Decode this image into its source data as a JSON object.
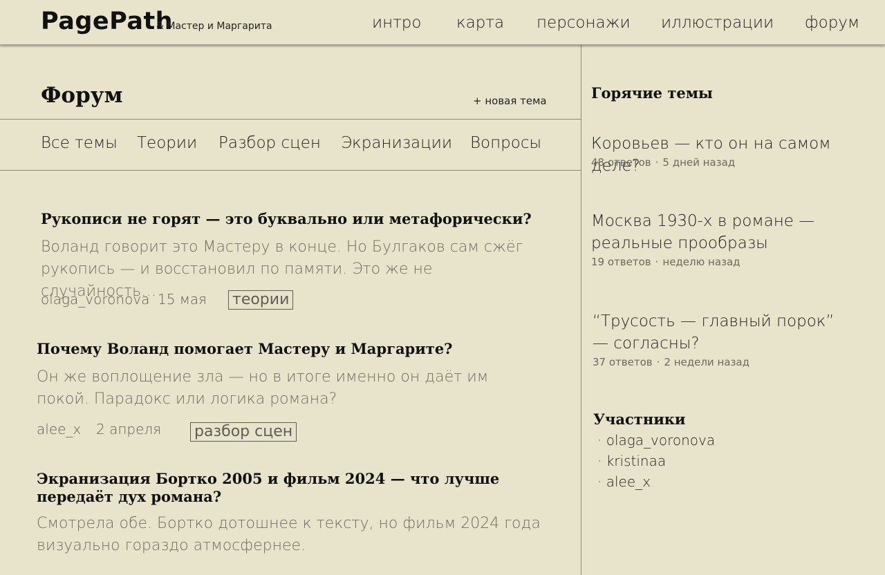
{
  "header": {
    "logo": "PagePath",
    "subtitle": "& Мастер и Маргарита",
    "nav": [
      "интро",
      "карта",
      "персонажи",
      "иллюстрации",
      "форум"
    ]
  },
  "forum": {
    "title": "Форум",
    "new_topic": "+ новая тема",
    "categories": [
      "Все темы",
      "Теории",
      "Разбор сцен",
      "Экранизации",
      "Вопросы"
    ]
  },
  "posts": [
    {
      "title": "Рукописи не горят — это буквально или метафорически?",
      "body": "Воланд говорит это Мастеру в конце. Но Булгаков сам сжёг рукопись — и восстановил по памяти. Это же не случайность…",
      "author": "olaga_voronova",
      "date": "15 мая",
      "tag": "теории"
    },
    {
      "title": "Почему Воланд помогает Мастеру и Маргарите?",
      "body": "Он же воплощение зла — но в итоге именно он даёт им покой. Парадокс или логика романа?",
      "author": "alee_x",
      "date": "2 апреля",
      "tag": "разбор сцен"
    },
    {
      "title": "Экранизация Бортко 2005 и фильм 2024 — что лучше передаёт дух романа?",
      "body": "Смотрела обе. Бортко дотошнее к тексту, но фильм 2024 года визуально гораздо атмосфернее."
    }
  ],
  "sidebar": {
    "hot_title": "Горячие темы",
    "hot": [
      {
        "title": "Коровьев — кто он на самом деле?",
        "replies": "48 ответов",
        "when": "5 дней назад"
      },
      {
        "title": "Москва 1930-х в романе — реальные прообразы",
        "replies": "19 ответов",
        "when": "неделю назад"
      },
      {
        "title": "“Трусость — главный порок” — согласны?",
        "replies": "37 ответов",
        "when": "2 недели назад"
      }
    ],
    "members_title": "Участники",
    "members": [
      "· olaga_voronova",
      "· kristinaa",
      "· alee_x"
    ],
    "separator": "·"
  }
}
